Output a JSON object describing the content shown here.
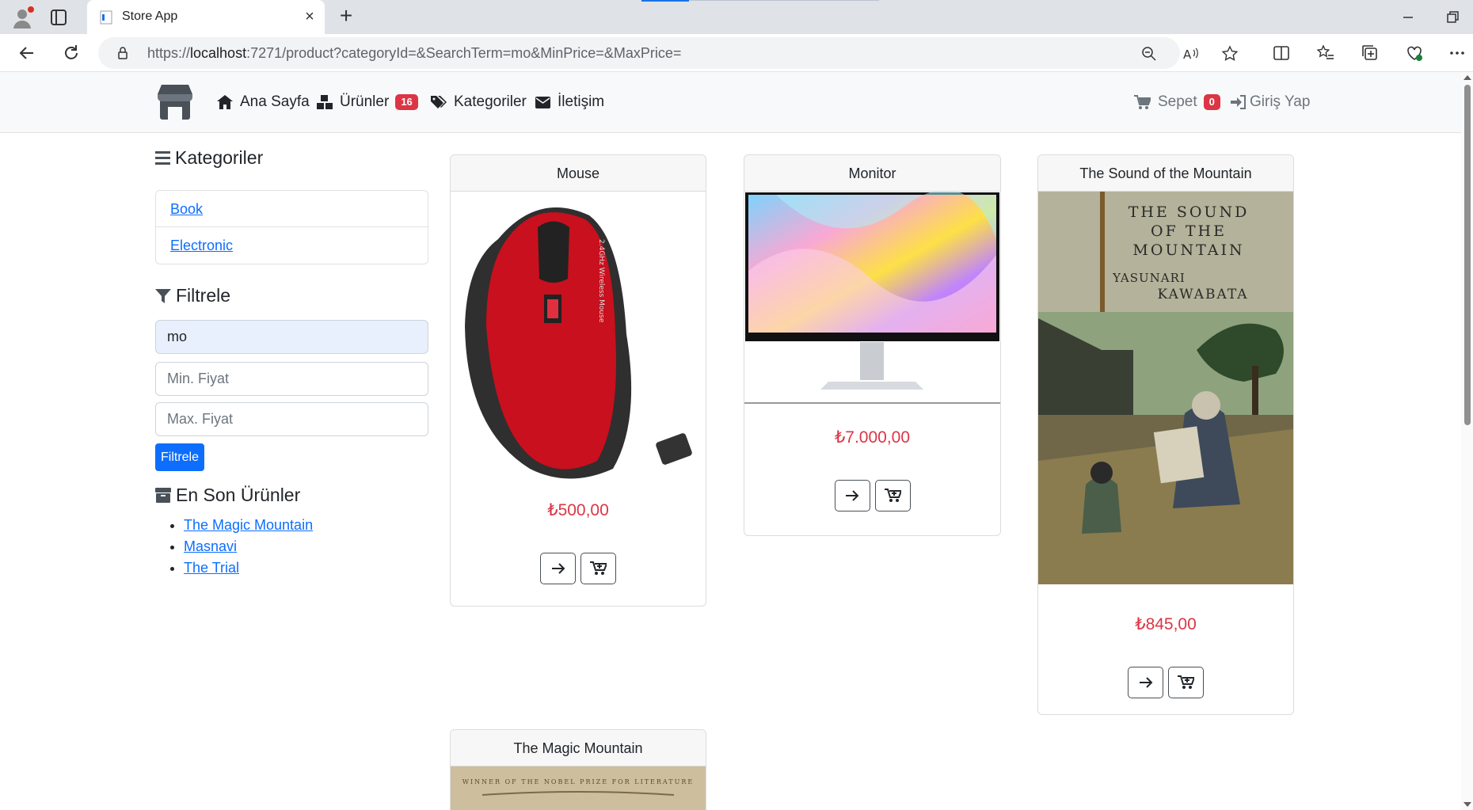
{
  "browser": {
    "tab_title": "Store App",
    "url_prefix": "https://",
    "url_host": "localhost",
    "url_rest": ":7271/product?categoryId=&SearchTerm=mo&MinPrice=&MaxPrice="
  },
  "navbar": {
    "home": "Ana Sayfa",
    "products": "Ürünler",
    "products_count": "16",
    "categories": "Kategoriler",
    "contact": "İletişim",
    "cart": "Sepet",
    "cart_count": "0",
    "login": "Giriş Yap"
  },
  "sidebar": {
    "categories_title": "Kategoriler",
    "categories": [
      "Book",
      "Electronic"
    ],
    "filter_title": "Filtrele",
    "search_value": "mo",
    "min_placeholder": "Min. Fiyat",
    "max_placeholder": "Max. Fiyat",
    "filter_button": "Filtrele",
    "recent_title": "En Son Ürünler",
    "recent": [
      "The Magic Mountain",
      "Masnavi",
      "The Trial"
    ]
  },
  "products": [
    {
      "name": "Mouse",
      "price": "₺500,00"
    },
    {
      "name": "Monitor",
      "price": "₺7.000,00"
    },
    {
      "name": "The Sound of the Mountain",
      "price": "₺845,00",
      "cover": {
        "line1": "THE SOUND",
        "line2": "OF THE",
        "line3": "MOUNTAIN",
        "author1": "YASUNARI",
        "author2": "KAWABATA"
      }
    },
    {
      "name": "The Magic Mountain",
      "cover_banner": "WINNER OF THE NOBEL PRIZE FOR LITERATURE"
    }
  ],
  "colors": {
    "primary": "#0d6efd",
    "danger": "#dc3545",
    "navbar_bg": "#f8f9fa"
  }
}
